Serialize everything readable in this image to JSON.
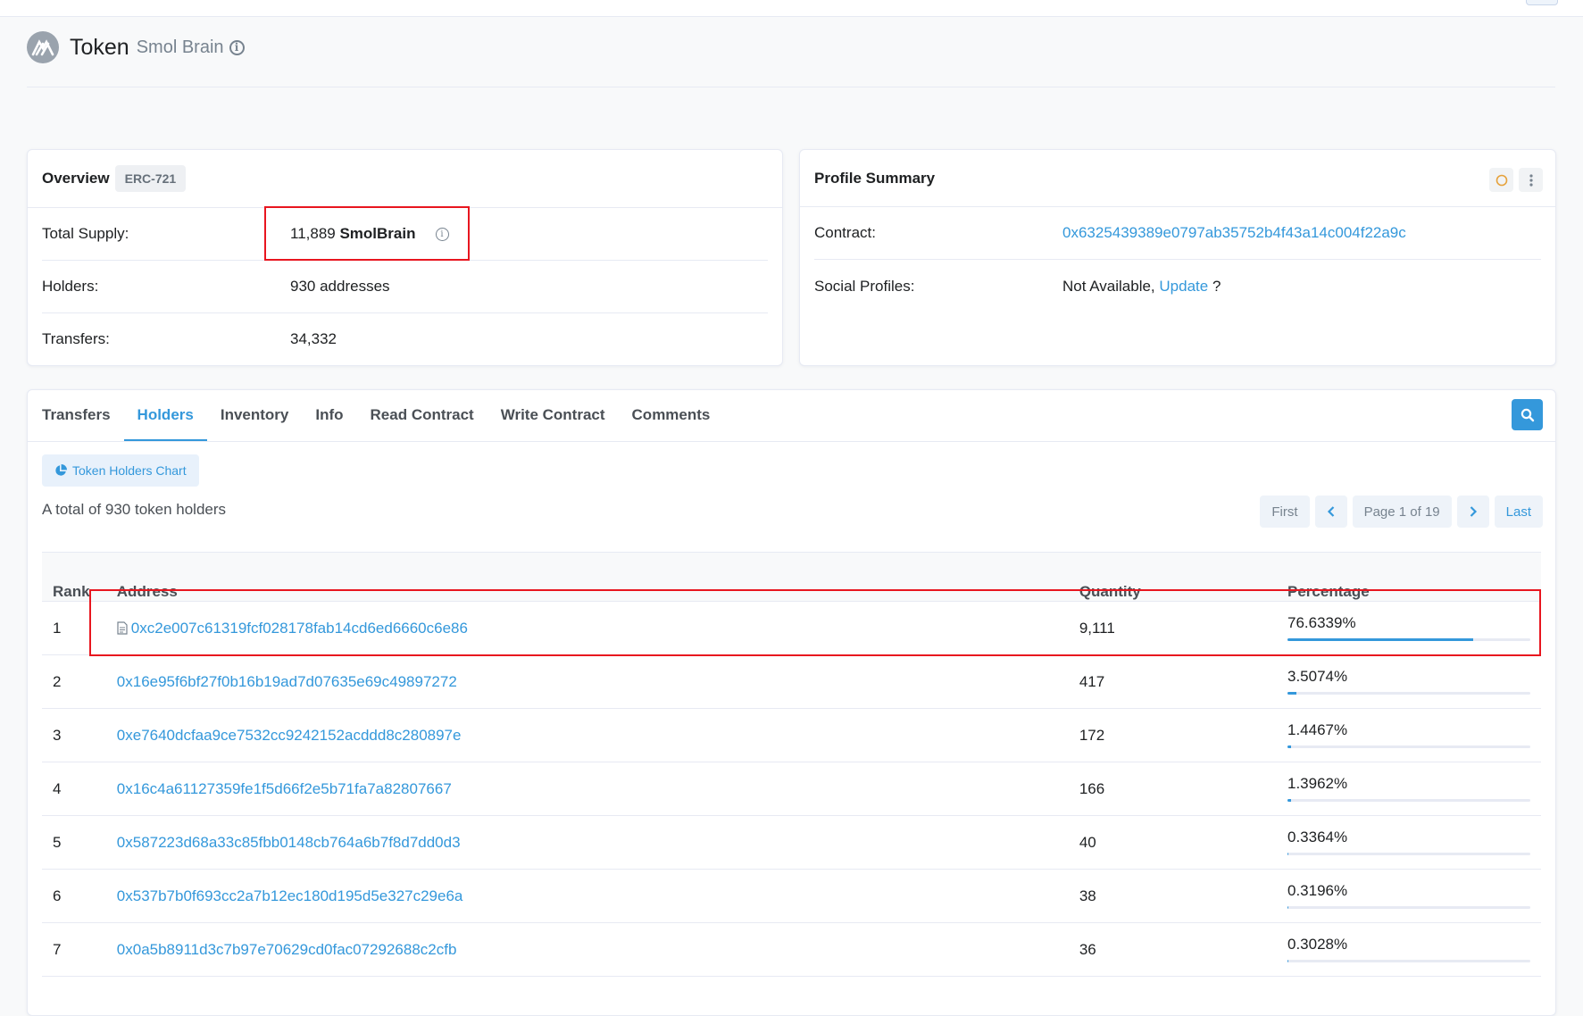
{
  "header": {
    "title": "Token",
    "subtitle": "Smol Brain"
  },
  "overview": {
    "title": "Overview",
    "badge": "ERC-721",
    "rows": {
      "total_supply": {
        "label": "Total Supply:",
        "value": "11,889",
        "symbol": "SmolBrain"
      },
      "holders": {
        "label": "Holders:",
        "value": "930 addresses"
      },
      "transfers": {
        "label": "Transfers:",
        "value": "34,332"
      }
    }
  },
  "profile": {
    "title": "Profile Summary",
    "contract_label": "Contract:",
    "contract_value": "0x6325439389e0797ab35752b4f43a14c004f22a9c",
    "social_label": "Social Profiles:",
    "social_value": "Not Available,",
    "social_link": "Update",
    "social_suffix": "?"
  },
  "tabs": [
    "Transfers",
    "Holders",
    "Inventory",
    "Info",
    "Read Contract",
    "Write Contract",
    "Comments"
  ],
  "active_tab": "Holders",
  "holders": {
    "chart_button": "Token Holders Chart",
    "total_text": "A total of 930 token holders",
    "pager": {
      "first": "First",
      "page": "Page 1 of 19",
      "last": "Last"
    },
    "columns": {
      "rank": "Rank",
      "address": "Address",
      "quantity": "Quantity",
      "percentage": "Percentage"
    },
    "rows": [
      {
        "rank": "1",
        "address": "0xc2e007c61319fcf028178fab14cd6ed6660c6e86",
        "is_contract": true,
        "quantity": "9,111",
        "percentage": "76.6339%",
        "pct": 76.6339
      },
      {
        "rank": "2",
        "address": "0x16e95f6bf27f0b16b19ad7d07635e69c49897272",
        "is_contract": false,
        "quantity": "417",
        "percentage": "3.5074%",
        "pct": 3.5074
      },
      {
        "rank": "3",
        "address": "0xe7640dcfaa9ce7532cc9242152acddd8c280897e",
        "is_contract": false,
        "quantity": "172",
        "percentage": "1.4467%",
        "pct": 1.4467
      },
      {
        "rank": "4",
        "address": "0x16c4a61127359fe1f5d66f2e5b71fa7a82807667",
        "is_contract": false,
        "quantity": "166",
        "percentage": "1.3962%",
        "pct": 1.3962
      },
      {
        "rank": "5",
        "address": "0x587223d68a33c85fbb0148cb764a6b7f8d7dd0d3",
        "is_contract": false,
        "quantity": "40",
        "percentage": "0.3364%",
        "pct": 0.3364
      },
      {
        "rank": "6",
        "address": "0x537b7b0f693cc2a7b12ec180d195d5e327c29e6a",
        "is_contract": false,
        "quantity": "38",
        "percentage": "0.3196%",
        "pct": 0.3196
      },
      {
        "rank": "7",
        "address": "0x0a5b8911d3c7b97e70629cd0fac07292688c2cfb",
        "is_contract": false,
        "quantity": "36",
        "percentage": "0.3028%",
        "pct": 0.3028
      }
    ]
  },
  "colors": {
    "accent": "#3498db",
    "highlight": "#e8161f"
  }
}
